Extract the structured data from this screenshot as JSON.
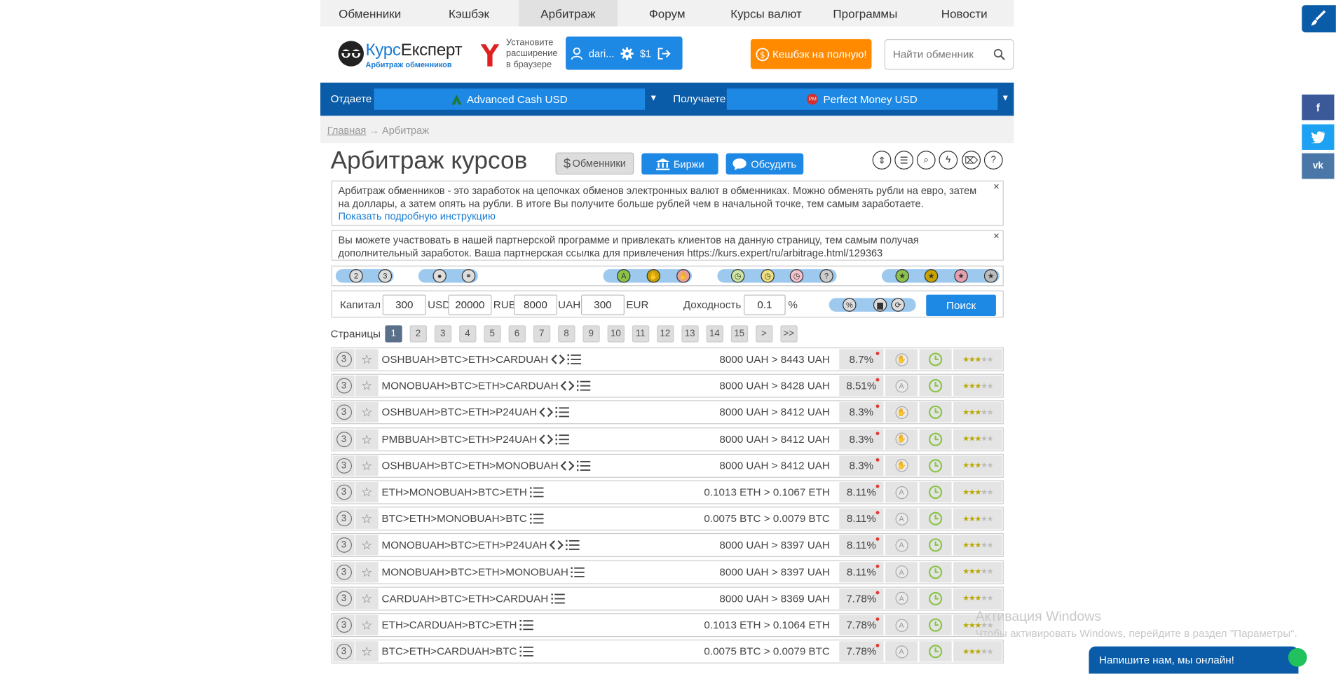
{
  "nav": [
    "Обменники",
    "Кэшбэк",
    "Арбитраж",
    "Форум",
    "Курсы валют",
    "Программы",
    "Новости"
  ],
  "nav_active_index": 2,
  "logo": {
    "part1": "Курс",
    "part2": "Експерт",
    "subtitle": "Арбитраж обменников"
  },
  "extension": {
    "line1": "Установите",
    "line2": "расширение",
    "line3": "в браузере"
  },
  "user": {
    "name": "dari...",
    "balance": "$1"
  },
  "cashback_button": "Кешбэк на полную!",
  "search": {
    "placeholder": "Найти обменник"
  },
  "currency": {
    "give_label": "Отдаете",
    "give_value": "Advanced Cash USD",
    "get_label": "Получаете",
    "get_value": "Perfect Money USD",
    "get_icon_text": "PM"
  },
  "breadcrumb": {
    "home": "Главная",
    "sep": "→",
    "current": "Арбитраж"
  },
  "page_title": "Арбитраж курсов",
  "buttons": {
    "exchangers": "Обменники",
    "exchanges": "Биржи",
    "discuss": "Обсудить"
  },
  "info1": {
    "text": "Арбитраж обменников - это заработок на цепочках обменов электронных валют в обменниках. Можно обменять рубли на евро, затем на доллары, а затем опять на рубли. В итоге Вы получите больше рублей чем в начальной точке, тем самым заработаете.",
    "link": "Показать подробную инструкцию",
    "close": "×"
  },
  "info2": {
    "text": "Вы можете участвовать в нашей партнерской программе и привлекать клиентов на данную страницу, тем самым получая дополнительный заработок. Ваша партнерская ссылка для привлечения https://kurs.expert/ru/arbitrage.html/129363",
    "close": "×"
  },
  "filter_labels": {
    "n2": "2",
    "n3": "3",
    "a": "A",
    "q": "?"
  },
  "capital": {
    "label": "Капитал",
    "usd_value": "300",
    "usd_label": "USD",
    "rub_value": "20000",
    "rub_label": "RUB",
    "uah_value": "8000",
    "uah_label": "UAH",
    "eur_value": "300",
    "eur_label": "EUR",
    "profit_label": "Доходность",
    "profit_value": "0.1",
    "profit_unit": "%",
    "search_button": "Поиск"
  },
  "pages": {
    "label": "Страницы",
    "items": [
      "1",
      "2",
      "3",
      "4",
      "5",
      "6",
      "7",
      "8",
      "9",
      "10",
      "11",
      "12",
      "13",
      "14",
      "15",
      ">",
      ">>"
    ],
    "active": "1"
  },
  "rows": [
    {
      "num": "3",
      "chain": "OSHBUAH>BTC>ETH>CARDUAH",
      "code": true,
      "amount": "8000 UAH > 8443 UAH",
      "pct": "8.7%",
      "icon": "hand",
      "rating": 3
    },
    {
      "num": "3",
      "chain": "MONOBUAH>BTC>ETH>CARDUAH",
      "code": true,
      "amount": "8000 UAH > 8428 UAH",
      "pct": "8.51%",
      "icon": "A",
      "rating": 3
    },
    {
      "num": "3",
      "chain": "OSHBUAH>BTC>ETH>P24UAH",
      "code": true,
      "amount": "8000 UAH > 8412 UAH",
      "pct": "8.3%",
      "icon": "hand",
      "rating": 3
    },
    {
      "num": "3",
      "chain": "PMBBUAH>BTC>ETH>P24UAH",
      "code": true,
      "amount": "8000 UAH > 8412 UAH",
      "pct": "8.3%",
      "icon": "hand",
      "rating": 3
    },
    {
      "num": "3",
      "chain": "OSHBUAH>BTC>ETH>MONOBUAH",
      "code": true,
      "amount": "8000 UAH > 8412 UAH",
      "pct": "8.3%",
      "icon": "hand",
      "rating": 3
    },
    {
      "num": "3",
      "chain": "ETH>MONOBUAH>BTC>ETH",
      "code": false,
      "amount": "0.1013 ETH > 0.1067 ETH",
      "pct": "8.11%",
      "icon": "A",
      "rating": 3
    },
    {
      "num": "3",
      "chain": "BTC>ETH>MONOBUAH>BTC",
      "code": false,
      "amount": "0.0075 BTC > 0.0079 BTC",
      "pct": "8.11%",
      "icon": "A",
      "rating": 3
    },
    {
      "num": "3",
      "chain": "MONOBUAH>BTC>ETH>P24UAH",
      "code": true,
      "amount": "8000 UAH > 8397 UAH",
      "pct": "8.11%",
      "icon": "A",
      "rating": 3
    },
    {
      "num": "3",
      "chain": "MONOBUAH>BTC>ETH>MONOBUAH",
      "code": false,
      "amount": "8000 UAH > 8397 UAH",
      "pct": "8.11%",
      "icon": "A",
      "rating": 3
    },
    {
      "num": "3",
      "chain": "CARDUAH>BTC>ETH>CARDUAH",
      "code": false,
      "amount": "8000 UAH > 8369 UAH",
      "pct": "7.78%",
      "icon": "A",
      "rating": 3
    },
    {
      "num": "3",
      "chain": "ETH>CARDUAH>BTC>ETH",
      "code": false,
      "amount": "0.1013 ETH > 0.1064 ETH",
      "pct": "7.78%",
      "icon": "A",
      "rating": 3
    },
    {
      "num": "3",
      "chain": "BTC>ETH>CARDUAH>BTC",
      "code": false,
      "amount": "0.0075 BTC > 0.0079 BTC",
      "pct": "7.78%",
      "icon": "A",
      "rating": 3
    }
  ],
  "windows": {
    "title": "Активация Windows",
    "text": "Чтобы активировать Windows, перейдите в раздел \"Параметры\"."
  },
  "chat": "Напишите нам, мы онлайн!",
  "colors": {
    "primary": "#1e88e5",
    "dark_blue": "#0a5ca8",
    "orange": "#ff8a00",
    "green_clock": "#8bc34a"
  }
}
